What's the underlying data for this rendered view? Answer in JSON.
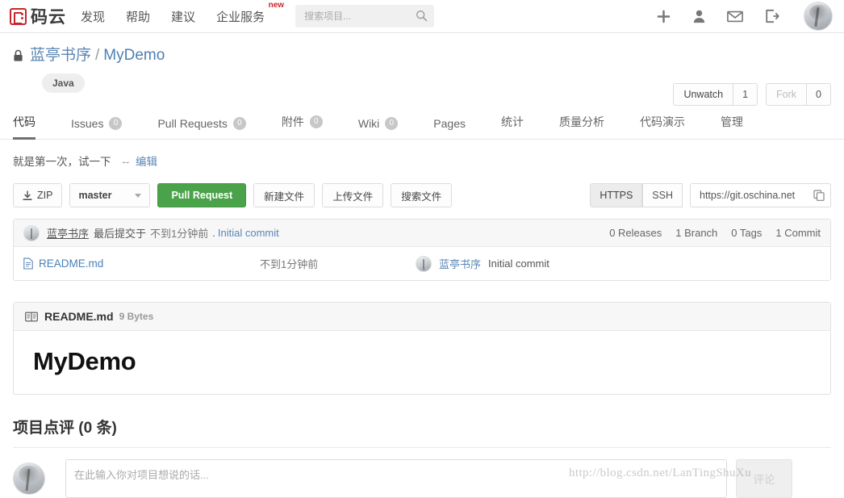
{
  "navbar": {
    "logo_text": "码云",
    "logo_icon": "mayun-logo-icon",
    "links": [
      {
        "label": "发现"
      },
      {
        "label": "帮助"
      },
      {
        "label": "建议"
      },
      {
        "label": "企业服务",
        "badge": "new"
      }
    ],
    "search": {
      "placeholder": "搜索项目...",
      "value": "",
      "icon": "search-icon"
    },
    "icons": [
      {
        "name": "plus-icon"
      },
      {
        "name": "user-icon"
      },
      {
        "name": "envelope-icon"
      },
      {
        "name": "logout-icon"
      }
    ],
    "avatar": "user-avatar"
  },
  "repo": {
    "lock_icon": "lock-icon",
    "owner": "蓝亭书序",
    "separator": "/",
    "name": "MyDemo",
    "language_tag": "Java",
    "watch": {
      "label": "Unwatch",
      "count": "1"
    },
    "fork": {
      "label": "Fork",
      "count": "0"
    },
    "description": "就是第一次，试一下",
    "desc_dashes": "--",
    "edit_label": "编辑"
  },
  "tabs": [
    {
      "label": "代码",
      "badge": null,
      "active": true
    },
    {
      "label": "Issues",
      "badge": "0",
      "active": false
    },
    {
      "label": "Pull Requests",
      "badge": "0",
      "active": false
    },
    {
      "label": "附件",
      "badge": "0",
      "active": false
    },
    {
      "label": "Wiki",
      "badge": "0",
      "active": false
    },
    {
      "label": "Pages",
      "badge": null,
      "active": false
    },
    {
      "label": "统计",
      "badge": null,
      "active": false
    },
    {
      "label": "质量分析",
      "badge": null,
      "active": false
    },
    {
      "label": "代码演示",
      "badge": null,
      "active": false
    },
    {
      "label": "管理",
      "badge": null,
      "active": false
    }
  ],
  "toolbar": {
    "zip_label": "ZIP",
    "zip_icon": "download-icon",
    "branch_label": "master",
    "branch_caret": "chevron-down-icon",
    "pull_request_label": "Pull Request",
    "new_file_label": "新建文件",
    "upload_file_label": "上传文件",
    "search_file_label": "搜索文件",
    "protocol_https": "HTTPS",
    "protocol_ssh": "SSH",
    "clone_url": "https://git.oschina.net",
    "copy_icon": "copy-icon",
    "accent_green": "#4aa34a"
  },
  "commit_bar": {
    "avatar": "committer-avatar",
    "author": "蓝亭书序",
    "committed_text": "最后提交于",
    "time": "不到1分钟前",
    "dot": ".",
    "message": "Initial commit",
    "stats": [
      "0 Releases",
      "1 Branch",
      "0 Tags",
      "1 Commit"
    ]
  },
  "file_list": {
    "columns": [
      "name",
      "time",
      "commit"
    ],
    "rows": [
      {
        "icon": "file-icon",
        "name": "README.md",
        "time": "不到1分钟前",
        "author_avatar": "committer-avatar",
        "author": "蓝亭书序",
        "message": "Initial commit"
      }
    ]
  },
  "readme": {
    "icon": "book-icon",
    "title": "README.md",
    "size": "9 Bytes",
    "heading": "MyDemo"
  },
  "comments": {
    "title": "项目点评 (0 条)",
    "avatar": "user-avatar",
    "placeholder": "在此输入你对项目想说的话...",
    "value": "",
    "submit_label": "评论"
  },
  "watermark": {
    "text": "http://blog.csdn.net/LanTingShuXu"
  }
}
